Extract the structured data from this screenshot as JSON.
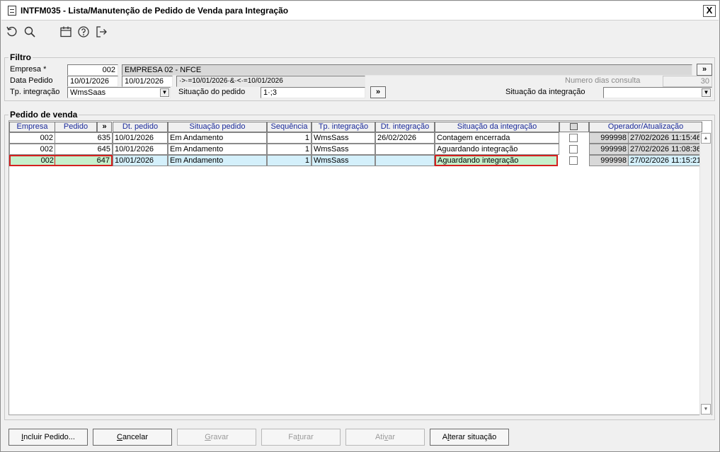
{
  "window": {
    "title": "INTFM035 - Lista/Manutenção de Pedido de Venda para Integração",
    "close_label": "X"
  },
  "toolbar": {
    "icons": [
      "undo-icon",
      "search-icon",
      "calendar-icon",
      "help-icon",
      "exit-icon"
    ]
  },
  "filter": {
    "legend": "Filtro",
    "empresa_label": "Empresa *",
    "empresa_code": "002",
    "empresa_name": "EMPRESA 02 - NFCE",
    "empresa_more": "»",
    "data_label": "Data Pedido",
    "data_from": "10/01/2026",
    "data_to": "10/01/2026",
    "data_expr": "·>·=10/01/2026·&·<·=10/01/2026",
    "dias_label": "Numero dias consulta",
    "dias_value": "30",
    "tp_label": "Tp. integração",
    "tp_value": "WmsSaas",
    "situacao_pedido_label": "Situação do pedido",
    "situacao_pedido_value": "1·;3",
    "situacao_pedido_more": "»",
    "situacao_integracao_label": "Situação da integração",
    "situacao_integracao_value": ""
  },
  "grid": {
    "legend": "Pedido de venda",
    "columns": {
      "empresa": "Empresa",
      "pedido": "Pedido",
      "more": "»",
      "dt_pedido": "Dt. pedido",
      "situacao_pedido": "Situação pedido",
      "sequencia": "Sequência",
      "tp_integracao": "Tp. integração",
      "dt_integracao": "Dt. integração",
      "situacao_integracao": "Situação da integração",
      "operador": "Operador/Atualização"
    },
    "rows": [
      {
        "empresa": "002",
        "pedido": "635",
        "dt_pedido": "10/01/2026",
        "situacao_pedido": "Em Andamento",
        "sequencia": "1",
        "tp_integracao": "WmsSass",
        "dt_integracao": "26/02/2026",
        "situacao_integracao": "Contagem encerrada",
        "operador": "999998",
        "atualizacao": "27/02/2026 11:15:46"
      },
      {
        "empresa": "002",
        "pedido": "645",
        "dt_pedido": "10/01/2026",
        "situacao_pedido": "Em Andamento",
        "sequencia": "1",
        "tp_integracao": "WmsSass",
        "dt_integracao": "",
        "situacao_integracao": "Aguardando integração",
        "operador": "999998",
        "atualizacao": "27/02/2026 11:08:36"
      },
      {
        "empresa": "002",
        "pedido": "647",
        "dt_pedido": "10/01/2026",
        "situacao_pedido": "Em Andamento",
        "sequencia": "1",
        "tp_integracao": "WmsSass",
        "dt_integracao": "",
        "situacao_integracao": "Aguardando integração",
        "operador": "999998",
        "atualizacao": "27/02/2026 11:15:21"
      }
    ]
  },
  "buttons": {
    "incluir": {
      "pre": "",
      "u": "I",
      "post": "ncluir Pedido..."
    },
    "cancelar": {
      "pre": "",
      "u": "C",
      "post": "ancelar"
    },
    "gravar": {
      "pre": "",
      "u": "G",
      "post": "ravar"
    },
    "faturar": {
      "pre": "Fa",
      "u": "t",
      "post": "urar"
    },
    "ativar": {
      "pre": "Ati",
      "u": "v",
      "post": "ar"
    },
    "alterar": {
      "pre": "A",
      "u": "l",
      "post": "terar situação"
    }
  },
  "colors": {
    "selected_row": "#d4f0fb",
    "selected_cell_green": "#c6f0cc",
    "highlight_border": "#d42020",
    "header_text": "#1a2a9a"
  }
}
